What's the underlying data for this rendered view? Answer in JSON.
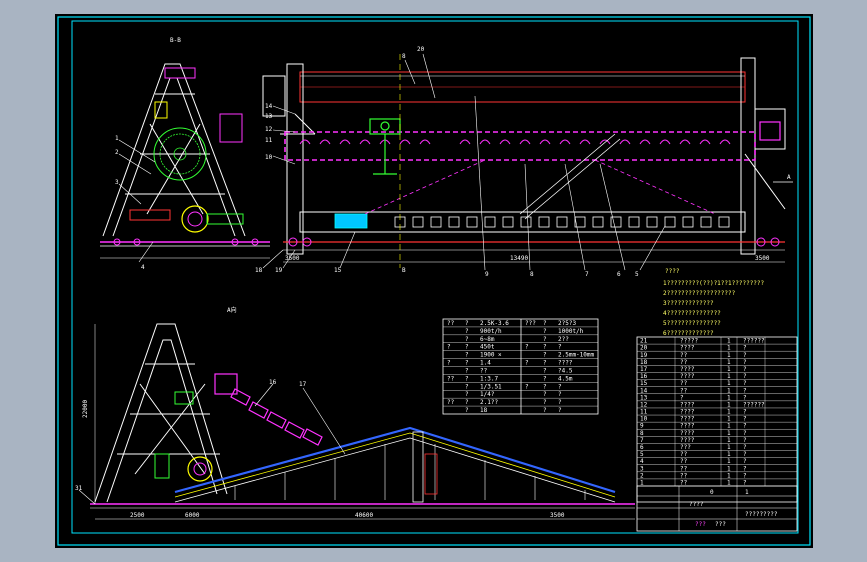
{
  "colors": {
    "app_bg": "#a9b4c2",
    "canvas": "#000000",
    "frame": "#00e5ff",
    "structure": "#ffffff",
    "highlight": "#ff33ff",
    "accent_green": "#33ff33",
    "accent_yellow": "#ffff00",
    "accent_red": "#ff3333",
    "accent_blue": "#3366ff",
    "accent_cyan": "#00ffff"
  },
  "views": {
    "section_b": {
      "label": "B-B"
    },
    "main_elevation": {
      "view_arrow": "A",
      "section_mark": "B",
      "callouts_top": [
        "20",
        "8"
      ],
      "callouts_left": [
        "14",
        "13",
        "12",
        "11",
        "10",
        "18",
        "19",
        "15"
      ],
      "callouts_bottom": [
        "9",
        "8",
        "7",
        "6",
        "5"
      ]
    },
    "side_view": {
      "label": "A向",
      "left_callouts": [
        "1",
        "2",
        "3",
        "4"
      ],
      "mid_callouts": [
        "16",
        "17"
      ],
      "corner_callout": "31"
    }
  },
  "notes": {
    "title": "????",
    "lines": [
      "1?????????(??)?1??1?????????",
      "2???????????????????",
      "3?????????????",
      "4???????????????",
      "5???????????????",
      "6?????????????"
    ]
  },
  "spec_table": {
    "rows": [
      [
        "??",
        "?",
        "2.5K-3.6",
        "???",
        "?",
        "2?5?3"
      ],
      [
        "",
        "?",
        "900t/h",
        "",
        "?",
        "1000t/h"
      ],
      [
        "",
        "?",
        "6~8m",
        "",
        "?",
        "2??"
      ],
      [
        "?",
        "?",
        "450t",
        "?",
        "?",
        "?"
      ],
      [
        "",
        "?",
        "1900 ×",
        "",
        "?",
        "2.5mm-10mm"
      ],
      [
        "?",
        "?",
        "1.4",
        "?",
        "?",
        "????"
      ],
      [
        "",
        "?",
        "??",
        "",
        "?",
        "?4.5"
      ],
      [
        "??",
        "?",
        "1:3.7",
        "",
        "?",
        "4.5m"
      ],
      [
        "",
        "?",
        "1/3.51",
        "?",
        "?",
        "?"
      ],
      [
        "",
        "?",
        "1/4?",
        "",
        "?",
        "?"
      ],
      [
        "??",
        "?",
        "2.1??",
        "",
        "?",
        "?"
      ],
      [
        "",
        "?",
        "18",
        "",
        "?",
        "?"
      ]
    ]
  },
  "parts_list": {
    "rows": [
      [
        "21",
        "?????",
        "1",
        "??????"
      ],
      [
        "20",
        "????",
        "1",
        "?"
      ],
      [
        "19",
        "??",
        "1",
        "?"
      ],
      [
        "18",
        "??",
        "1",
        "?"
      ],
      [
        "17",
        "????",
        "1",
        "?"
      ],
      [
        "16",
        "????",
        "1",
        "?"
      ],
      [
        "15",
        "??",
        "1",
        "?"
      ],
      [
        "14",
        "??",
        "1",
        "?"
      ],
      [
        "13",
        "?",
        "1",
        "?"
      ],
      [
        "12",
        "????",
        "1",
        "??????"
      ],
      [
        "11",
        "????",
        "1",
        "?"
      ],
      [
        "10",
        "????",
        "1",
        "?"
      ],
      [
        "9",
        "????",
        "1",
        "?"
      ],
      [
        "8",
        "????",
        "1",
        "?"
      ],
      [
        "7",
        "????",
        "1",
        "?"
      ],
      [
        "6",
        "???",
        "1",
        "?"
      ],
      [
        "5",
        "??",
        "1",
        "?"
      ],
      [
        "4",
        "??",
        "1",
        "?"
      ],
      [
        "3",
        "??",
        "1",
        "?"
      ],
      [
        "2",
        "??",
        "1",
        "?"
      ],
      [
        "1",
        "??",
        "1",
        "?"
      ]
    ]
  },
  "title_block": {
    "title": "????",
    "drawing_no": "?????????",
    "code1": "???",
    "code2": "???",
    "sheet_cells": [
      "0",
      "1"
    ]
  },
  "dimensions": {
    "top_view": [
      "3500",
      "13490",
      "3500"
    ],
    "side_view": [
      "2500",
      "6000",
      "40600",
      "3500"
    ],
    "height": "22000"
  }
}
